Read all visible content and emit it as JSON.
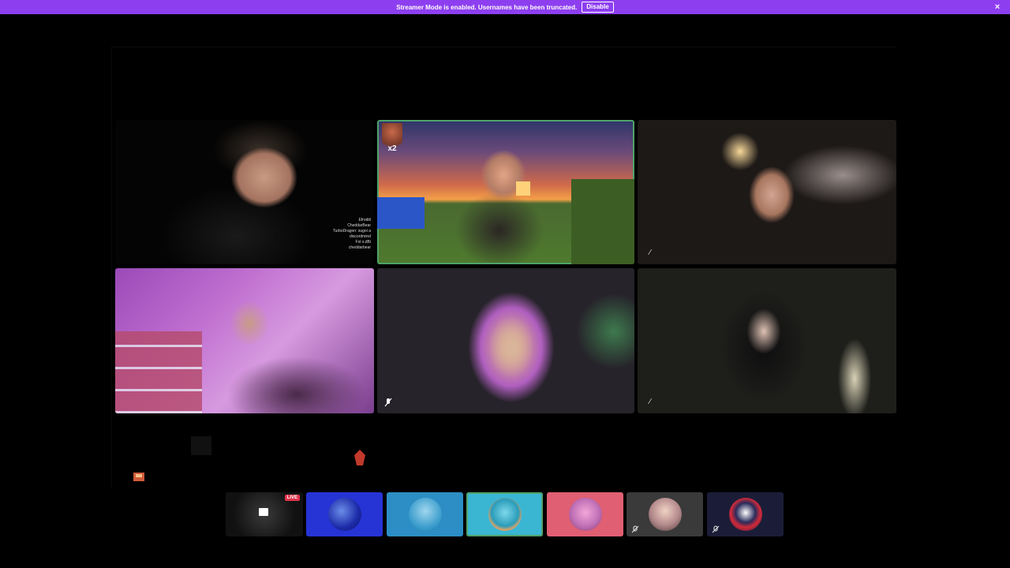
{
  "banner": {
    "message": "Streamer Mode is enabled. Usernames have been truncated.",
    "disable_label": "Disable",
    "close_icon": "×",
    "color": "#8d3ff0"
  },
  "tiles": [
    {
      "id": "participant-1",
      "chat_lines": [
        "Efroditi",
        "CheddarBear",
        "TurboDragon: sugoi a",
        "discordmind",
        "Fol s.dBi",
        "cheddarbear"
      ]
    },
    {
      "id": "participant-2",
      "active": true,
      "overlay_text": "x2",
      "active_border_color": "#4ea36a"
    },
    {
      "id": "participant-3",
      "mute_icon": "mic-off-icon"
    },
    {
      "id": "participant-4"
    },
    {
      "id": "participant-5"
    },
    {
      "id": "participant-6",
      "mute_icon": "mic-off-icon"
    }
  ],
  "strip": {
    "live_label": "LIVE",
    "participants": [
      {
        "id": "stream-preview",
        "live": true
      },
      {
        "id": "avatar-blue"
      },
      {
        "id": "avatar-sky"
      },
      {
        "id": "avatar-cyan",
        "speaking": true
      },
      {
        "id": "avatar-pink"
      },
      {
        "id": "avatar-gray",
        "muted": true
      },
      {
        "id": "avatar-navy",
        "muted": true
      }
    ]
  }
}
